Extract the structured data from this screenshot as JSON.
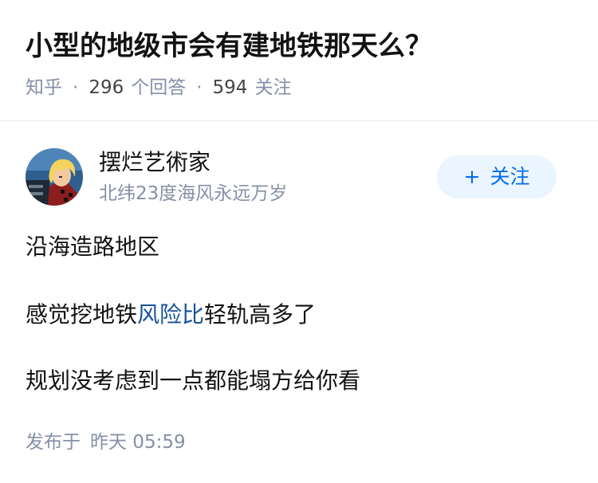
{
  "question": {
    "title": "小型的地级市会有建地铁那天么？",
    "source": "知乎",
    "answer_count": "296",
    "answer_label": "个回答",
    "follower_count": "594",
    "follower_label": "关注"
  },
  "author": {
    "name": "摆烂艺術家",
    "bio": "北纬23度海风永远万岁",
    "follow_plus": "+",
    "follow_label": "关注"
  },
  "answer": {
    "line1": "沿海造路地区",
    "line2_before": "感觉挖地铁",
    "line2_link": "风险比",
    "line2_after": "轻轨高多了",
    "line3": "规划没考虑到一点都能塌方给你看"
  },
  "footer": {
    "publish_label": "发布于",
    "publish_time": "昨天 05:59"
  },
  "colors": {
    "accent": "#056de8",
    "meta": "#8590a6",
    "link": "#175199",
    "follow_bg": "#ebf5ff"
  }
}
